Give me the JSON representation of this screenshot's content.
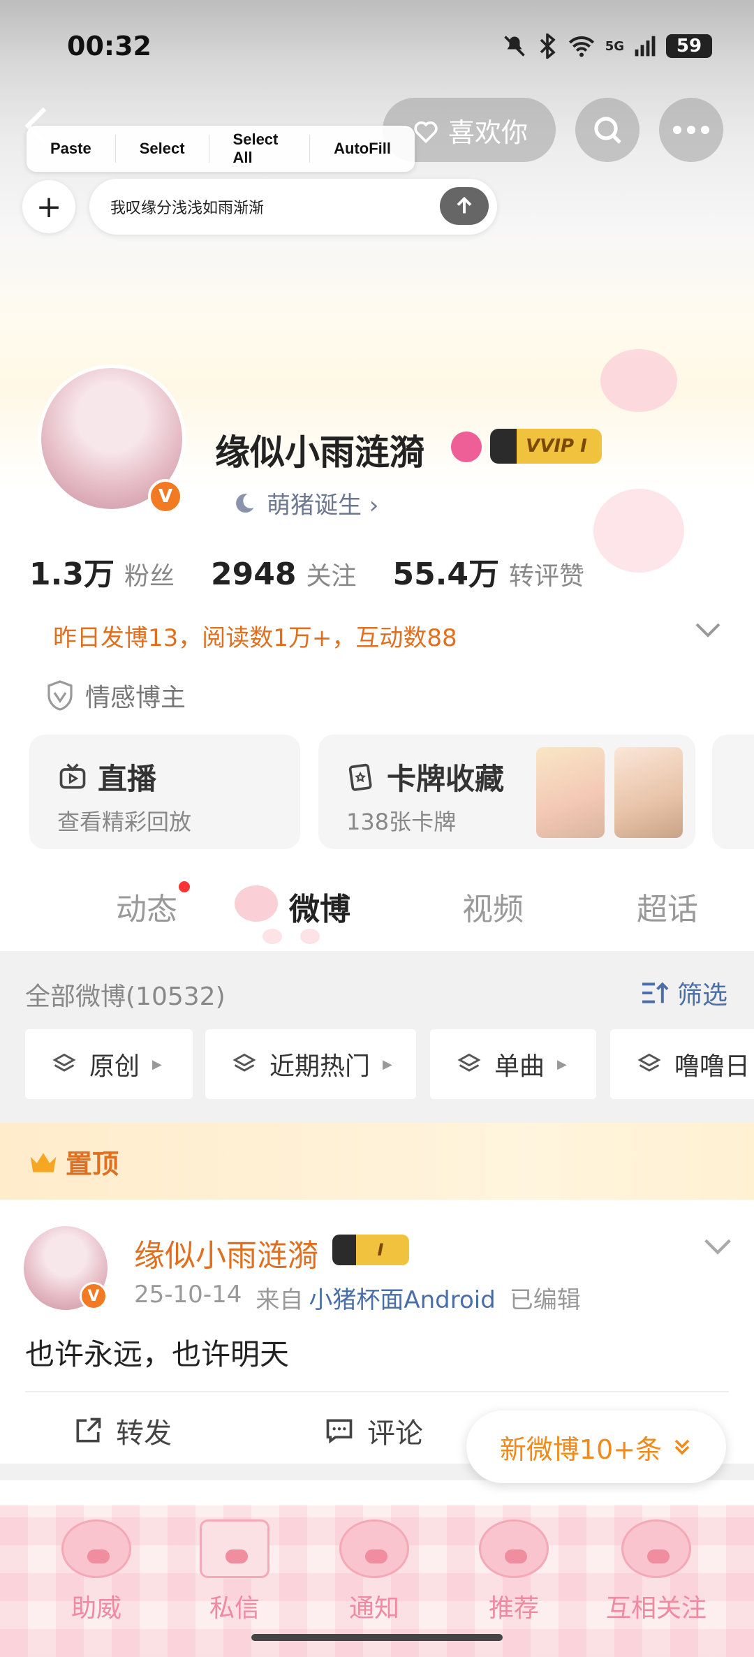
{
  "status_bar": {
    "time": "00:32",
    "network": "5G",
    "battery": "59"
  },
  "top_bar": {
    "like_label": "喜欢你"
  },
  "selection_menu": {
    "items": [
      "Paste",
      "Select",
      "Select All",
      "AutoFill"
    ]
  },
  "composer": {
    "input_text": "我叹缘分浅浅如雨渐渐"
  },
  "profile": {
    "name": "缘似小雨涟漪",
    "vip_label": "VVIP I",
    "verified_mark": "V",
    "birthday_label": "萌猪诞生 ›",
    "stats": [
      {
        "num": "1.3万",
        "label": "粉丝"
      },
      {
        "num": "2948",
        "label": "关注"
      },
      {
        "num": "55.4万",
        "label": "转评赞"
      }
    ],
    "daily_summary": "昨日发博13，阅读数1万+，互动数88",
    "tag": "情感博主"
  },
  "cards": [
    {
      "title": "直播",
      "sub": "查看精彩回放"
    },
    {
      "title": "卡牌收藏",
      "sub": "138张卡牌"
    }
  ],
  "tabs": [
    {
      "label": "动态"
    },
    {
      "label": "微博"
    },
    {
      "label": "视频"
    },
    {
      "label": "超话"
    }
  ],
  "feed_header": {
    "all_label": "全部微博(10532)",
    "filter_label": "筛选"
  },
  "chips": [
    "原创",
    "近期热门",
    "单曲",
    "噜噜日"
  ],
  "pinned_label": "置顶",
  "post": {
    "author": "缘似小雨涟漪",
    "vip_label": "I",
    "date": "25-10-14",
    "from_label": "来自",
    "source": "小猪杯面Android",
    "edited": "已编辑",
    "text": "也许永远，也许明天",
    "repost_label": "转发",
    "comment_label": "评论"
  },
  "new_posts_label": "新微博10+条",
  "bottom_nav": [
    "助威",
    "私信",
    "通知",
    "推荐",
    "互相关注"
  ]
}
